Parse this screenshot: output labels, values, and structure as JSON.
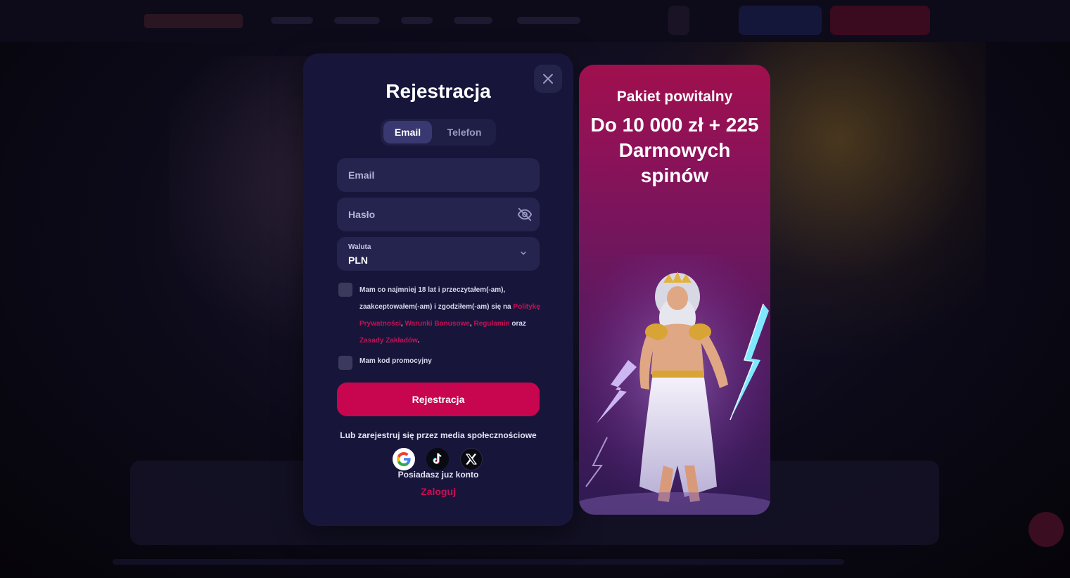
{
  "modal": {
    "title": "Rejestracja",
    "tabs": [
      {
        "label": "Email",
        "active": true
      },
      {
        "label": "Telefon",
        "active": false
      }
    ],
    "email_placeholder": "Email",
    "password_placeholder": "Hasło",
    "currency": {
      "label": "Waluta",
      "value": "PLN"
    },
    "terms": {
      "text_1": "Mam co najmniej 18 lat i przeczytałem(-am), zaakceptowałem(-am) i zgodziłem(-am) się na",
      "link_privacy": "Politykę Prywatności",
      "sep_1": ",",
      "link_bonus": "Warunki Bonusowe",
      "sep_2": ",",
      "link_rules": "Regulamin",
      "conj": "oraz",
      "link_betting": "Zasady Zakładów",
      "end": "."
    },
    "promo_code_label": "Mam kod promocyjny",
    "submit_label": "Rejestracja",
    "social_text": "Lub zarejestruj się przez media społecznościowe",
    "social_icons": [
      "google-icon",
      "tiktok-icon",
      "x-icon"
    ],
    "account_text": "Posiadasz juz konto",
    "login_label": "Zaloguj"
  },
  "promo": {
    "kicker": "Pakiet powitalny",
    "headline": "Do 10 000 zł + 225 Darmowych spinów"
  },
  "colors": {
    "accent": "#c8054f",
    "modal_bg": "#17163a",
    "field_bg": "#25244e"
  }
}
